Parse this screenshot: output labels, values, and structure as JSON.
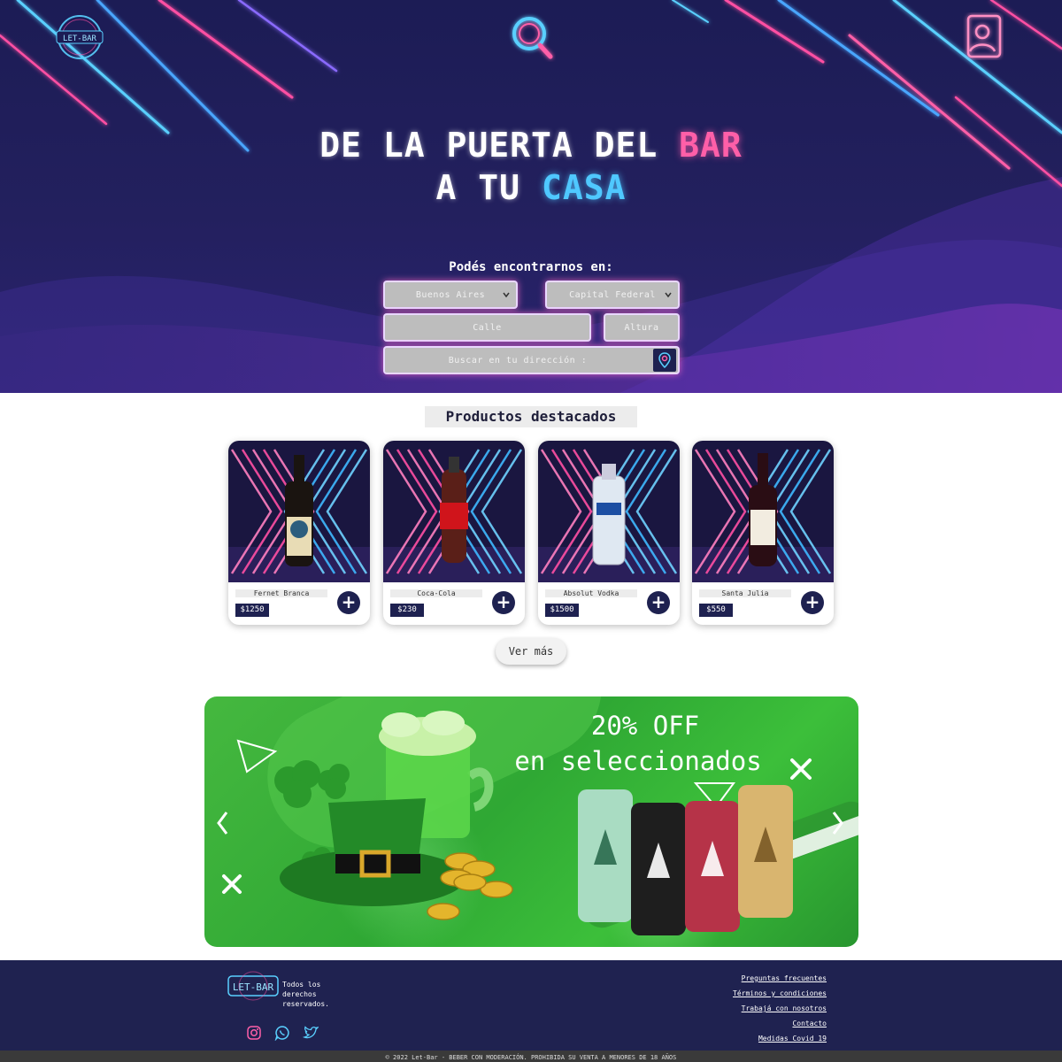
{
  "header": {
    "logo_text": "LET-BAR",
    "search_icon": "search-icon",
    "user_icon": "user-icon"
  },
  "hero": {
    "line1_prefix": "DE LA PUERTA DEL ",
    "line1_highlight": "BAR",
    "line2_prefix": "A TU ",
    "line2_highlight": "CASA",
    "find_label": "Podés encontrarnos en:",
    "province_select": "Buenos Aires",
    "city_select": "Capital Federal",
    "street_placeholder": "Calle",
    "number_placeholder": "Altura",
    "search_address_label": "Buscar en tu dirección :",
    "location_icon": "location-pin-icon",
    "colors": {
      "pink": "#ff5fa8",
      "blue": "#4fc8ff",
      "background": "#1c1c55"
    }
  },
  "featured": {
    "title": "Productos destacados",
    "products": [
      {
        "name": "Fernet Branca",
        "price": "$1250",
        "image": "fernet-bottle"
      },
      {
        "name": "Coca-Cola",
        "price": "$230",
        "image": "coca-cola-bottle"
      },
      {
        "name": "Absolut Vodka",
        "price": "$1500",
        "image": "vodka-bottle"
      },
      {
        "name": "Santa Julia",
        "price": "$550",
        "image": "wine-bottle"
      }
    ],
    "add_label": "+",
    "more_label": "Ver más"
  },
  "banner": {
    "line1": "20% OFF",
    "line2": "en seleccionados",
    "prev_icon": "chevron-left-icon",
    "next_icon": "chevron-right-icon",
    "accent": "#2fa834"
  },
  "footer": {
    "logo_text": "LET-BAR",
    "rights": "Todos los derechos reservados.",
    "social_icons": [
      "instagram-icon",
      "whatsapp-icon",
      "twitter-icon"
    ],
    "links": [
      "Preguntas frecuentes",
      "Términos y condiciones",
      "Trabajá con nosotros",
      "Contacto",
      "Medidas Covid 19"
    ],
    "bottom_text": "© 2022 Let-Bar - BEBER CON MODERACIÓN. PROHIBIDA SU VENTA A MENORES DE 18 AÑOS"
  }
}
